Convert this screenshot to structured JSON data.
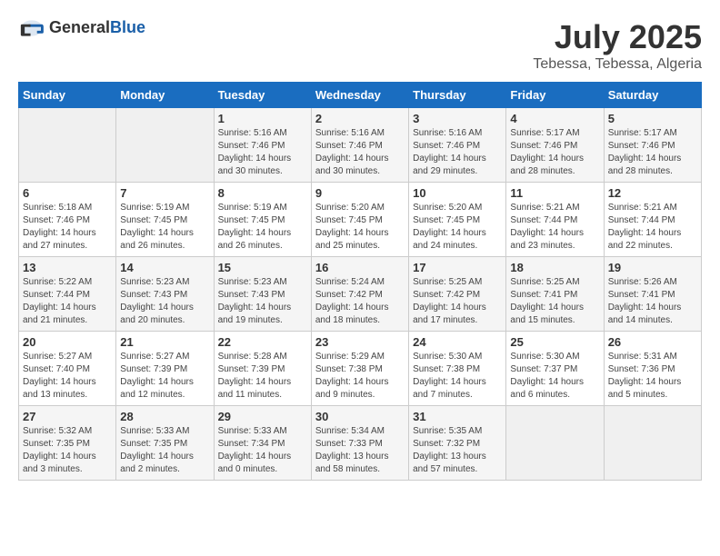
{
  "logo": {
    "general": "General",
    "blue": "Blue"
  },
  "title": "July 2025",
  "location": "Tebessa, Tebessa, Algeria",
  "days_header": [
    "Sunday",
    "Monday",
    "Tuesday",
    "Wednesday",
    "Thursday",
    "Friday",
    "Saturday"
  ],
  "weeks": [
    [
      {
        "day": "",
        "sunrise": "",
        "sunset": "",
        "daylight": ""
      },
      {
        "day": "",
        "sunrise": "",
        "sunset": "",
        "daylight": ""
      },
      {
        "day": "1",
        "sunrise": "Sunrise: 5:16 AM",
        "sunset": "Sunset: 7:46 PM",
        "daylight": "Daylight: 14 hours and 30 minutes."
      },
      {
        "day": "2",
        "sunrise": "Sunrise: 5:16 AM",
        "sunset": "Sunset: 7:46 PM",
        "daylight": "Daylight: 14 hours and 30 minutes."
      },
      {
        "day": "3",
        "sunrise": "Sunrise: 5:16 AM",
        "sunset": "Sunset: 7:46 PM",
        "daylight": "Daylight: 14 hours and 29 minutes."
      },
      {
        "day": "4",
        "sunrise": "Sunrise: 5:17 AM",
        "sunset": "Sunset: 7:46 PM",
        "daylight": "Daylight: 14 hours and 28 minutes."
      },
      {
        "day": "5",
        "sunrise": "Sunrise: 5:17 AM",
        "sunset": "Sunset: 7:46 PM",
        "daylight": "Daylight: 14 hours and 28 minutes."
      }
    ],
    [
      {
        "day": "6",
        "sunrise": "Sunrise: 5:18 AM",
        "sunset": "Sunset: 7:46 PM",
        "daylight": "Daylight: 14 hours and 27 minutes."
      },
      {
        "day": "7",
        "sunrise": "Sunrise: 5:19 AM",
        "sunset": "Sunset: 7:45 PM",
        "daylight": "Daylight: 14 hours and 26 minutes."
      },
      {
        "day": "8",
        "sunrise": "Sunrise: 5:19 AM",
        "sunset": "Sunset: 7:45 PM",
        "daylight": "Daylight: 14 hours and 26 minutes."
      },
      {
        "day": "9",
        "sunrise": "Sunrise: 5:20 AM",
        "sunset": "Sunset: 7:45 PM",
        "daylight": "Daylight: 14 hours and 25 minutes."
      },
      {
        "day": "10",
        "sunrise": "Sunrise: 5:20 AM",
        "sunset": "Sunset: 7:45 PM",
        "daylight": "Daylight: 14 hours and 24 minutes."
      },
      {
        "day": "11",
        "sunrise": "Sunrise: 5:21 AM",
        "sunset": "Sunset: 7:44 PM",
        "daylight": "Daylight: 14 hours and 23 minutes."
      },
      {
        "day": "12",
        "sunrise": "Sunrise: 5:21 AM",
        "sunset": "Sunset: 7:44 PM",
        "daylight": "Daylight: 14 hours and 22 minutes."
      }
    ],
    [
      {
        "day": "13",
        "sunrise": "Sunrise: 5:22 AM",
        "sunset": "Sunset: 7:44 PM",
        "daylight": "Daylight: 14 hours and 21 minutes."
      },
      {
        "day": "14",
        "sunrise": "Sunrise: 5:23 AM",
        "sunset": "Sunset: 7:43 PM",
        "daylight": "Daylight: 14 hours and 20 minutes."
      },
      {
        "day": "15",
        "sunrise": "Sunrise: 5:23 AM",
        "sunset": "Sunset: 7:43 PM",
        "daylight": "Daylight: 14 hours and 19 minutes."
      },
      {
        "day": "16",
        "sunrise": "Sunrise: 5:24 AM",
        "sunset": "Sunset: 7:42 PM",
        "daylight": "Daylight: 14 hours and 18 minutes."
      },
      {
        "day": "17",
        "sunrise": "Sunrise: 5:25 AM",
        "sunset": "Sunset: 7:42 PM",
        "daylight": "Daylight: 14 hours and 17 minutes."
      },
      {
        "day": "18",
        "sunrise": "Sunrise: 5:25 AM",
        "sunset": "Sunset: 7:41 PM",
        "daylight": "Daylight: 14 hours and 15 minutes."
      },
      {
        "day": "19",
        "sunrise": "Sunrise: 5:26 AM",
        "sunset": "Sunset: 7:41 PM",
        "daylight": "Daylight: 14 hours and 14 minutes."
      }
    ],
    [
      {
        "day": "20",
        "sunrise": "Sunrise: 5:27 AM",
        "sunset": "Sunset: 7:40 PM",
        "daylight": "Daylight: 14 hours and 13 minutes."
      },
      {
        "day": "21",
        "sunrise": "Sunrise: 5:27 AM",
        "sunset": "Sunset: 7:39 PM",
        "daylight": "Daylight: 14 hours and 12 minutes."
      },
      {
        "day": "22",
        "sunrise": "Sunrise: 5:28 AM",
        "sunset": "Sunset: 7:39 PM",
        "daylight": "Daylight: 14 hours and 11 minutes."
      },
      {
        "day": "23",
        "sunrise": "Sunrise: 5:29 AM",
        "sunset": "Sunset: 7:38 PM",
        "daylight": "Daylight: 14 hours and 9 minutes."
      },
      {
        "day": "24",
        "sunrise": "Sunrise: 5:30 AM",
        "sunset": "Sunset: 7:38 PM",
        "daylight": "Daylight: 14 hours and 7 minutes."
      },
      {
        "day": "25",
        "sunrise": "Sunrise: 5:30 AM",
        "sunset": "Sunset: 7:37 PM",
        "daylight": "Daylight: 14 hours and 6 minutes."
      },
      {
        "day": "26",
        "sunrise": "Sunrise: 5:31 AM",
        "sunset": "Sunset: 7:36 PM",
        "daylight": "Daylight: 14 hours and 5 minutes."
      }
    ],
    [
      {
        "day": "27",
        "sunrise": "Sunrise: 5:32 AM",
        "sunset": "Sunset: 7:35 PM",
        "daylight": "Daylight: 14 hours and 3 minutes."
      },
      {
        "day": "28",
        "sunrise": "Sunrise: 5:33 AM",
        "sunset": "Sunset: 7:35 PM",
        "daylight": "Daylight: 14 hours and 2 minutes."
      },
      {
        "day": "29",
        "sunrise": "Sunrise: 5:33 AM",
        "sunset": "Sunset: 7:34 PM",
        "daylight": "Daylight: 14 hours and 0 minutes."
      },
      {
        "day": "30",
        "sunrise": "Sunrise: 5:34 AM",
        "sunset": "Sunset: 7:33 PM",
        "daylight": "Daylight: 13 hours and 58 minutes."
      },
      {
        "day": "31",
        "sunrise": "Sunrise: 5:35 AM",
        "sunset": "Sunset: 7:32 PM",
        "daylight": "Daylight: 13 hours and 57 minutes."
      },
      {
        "day": "",
        "sunrise": "",
        "sunset": "",
        "daylight": ""
      },
      {
        "day": "",
        "sunrise": "",
        "sunset": "",
        "daylight": ""
      }
    ]
  ]
}
